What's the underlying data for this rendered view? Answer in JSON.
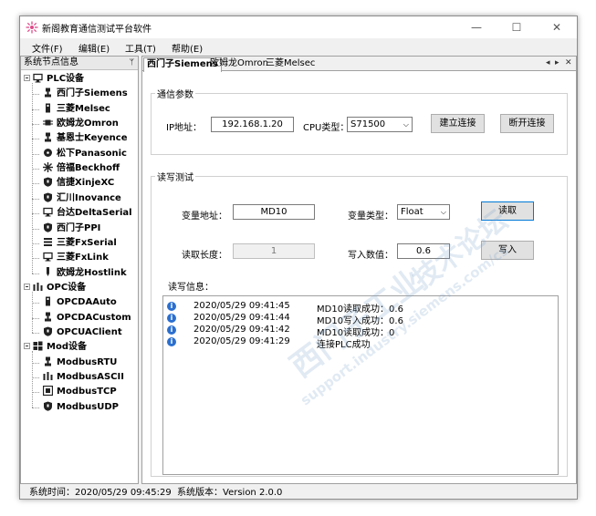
{
  "window": {
    "title": "新阁教育通信测试平台软件",
    "controls": {
      "minimize": "—",
      "maximize": "☐",
      "close": "✕"
    }
  },
  "menu": [
    "文件(F)",
    "编辑(E)",
    "工具(T)",
    "帮助(E)"
  ],
  "left_panel": {
    "title": "系统节点信息",
    "pin": "ᛘ",
    "groups": [
      {
        "label": "PLC设备",
        "icon": "monitor-icon",
        "items": [
          {
            "label": "西门子Siemens",
            "icon": "plc-icon"
          },
          {
            "label": "三菱Melsec",
            "icon": "device-icon"
          },
          {
            "label": "欧姆龙Omron",
            "icon": "chip-icon"
          },
          {
            "label": "基恩士Keyence",
            "icon": "plc-icon"
          },
          {
            "label": "松下Panasonic",
            "icon": "fan-icon"
          },
          {
            "label": "倍福Beckhoff",
            "icon": "star-icon"
          },
          {
            "label": "信捷XinjeXC",
            "icon": "shield-icon"
          },
          {
            "label": "汇川Inovance",
            "icon": "shield-icon"
          },
          {
            "label": "台达DeltaSerial",
            "icon": "monitor-icon"
          },
          {
            "label": "西门子PPI",
            "icon": "shield-icon"
          },
          {
            "label": "三菱FxSerial",
            "icon": "list-icon"
          },
          {
            "label": "三菱FxLink",
            "icon": "monitor-icon"
          },
          {
            "label": "欧姆龙Hostlink",
            "icon": "pen-icon"
          }
        ]
      },
      {
        "label": "OPC设备",
        "icon": "bars-icon",
        "items": [
          {
            "label": "OPCDAAuto",
            "icon": "device-icon"
          },
          {
            "label": "OPCDACustom",
            "icon": "plc-icon"
          },
          {
            "label": "OPCUAClient",
            "icon": "shield-icon"
          }
        ]
      },
      {
        "label": "Mod设备",
        "icon": "windows-icon",
        "items": [
          {
            "label": "ModbusRTU",
            "icon": "plc-icon"
          },
          {
            "label": "ModbusASCII",
            "icon": "bars-icon"
          },
          {
            "label": "ModbusTCP",
            "icon": "link-icon"
          },
          {
            "label": "ModbusUDP",
            "icon": "shield-icon"
          }
        ]
      }
    ]
  },
  "tabs": [
    "西门子Siemens",
    "欧姆龙Omron",
    "三菱Melsec"
  ],
  "tab_controls": {
    "prev": "◂",
    "next": "▸",
    "close": "✕"
  },
  "comm": {
    "title": "通信参数",
    "ip_label": "IP地址：",
    "ip_value": "192.168.1.20",
    "cpu_label": "CPU类型：",
    "cpu_value": "S71500",
    "connect": "建立连接",
    "disconnect": "断开连接"
  },
  "rw": {
    "title": "读写测试",
    "addr_label": "变量地址：",
    "addr_value": "MD10",
    "type_label": "变量类型：",
    "type_value": "Float",
    "read": "读取",
    "len_label": "读取长度：",
    "len_value": "1",
    "write_label": "写入数值：",
    "write_value": "0.6",
    "write": "写入"
  },
  "log": {
    "title": "读写信息：",
    "entries": [
      {
        "time": "2020/05/29 09:41:45",
        "msg": "MD10读取成功：0.6"
      },
      {
        "time": "2020/05/29 09:41:44",
        "msg": "MD10写入成功：0.6"
      },
      {
        "time": "2020/05/29 09:41:42",
        "msg": "MD10读取成功：0"
      },
      {
        "time": "2020/05/29 09:41:29",
        "msg": "连接PLC成功"
      }
    ]
  },
  "status": {
    "time_label": "系统时间：",
    "time_value": "2020/05/29 09:45:29",
    "version_label": "系统版本：",
    "version_value": "Version 2.0.0"
  },
  "watermark": [
    "西门子工业",
    "技术论坛",
    "support.industry.siemens.com/cs"
  ],
  "colors": {
    "accent": "#0078d7",
    "info": "#2b6fd0"
  }
}
